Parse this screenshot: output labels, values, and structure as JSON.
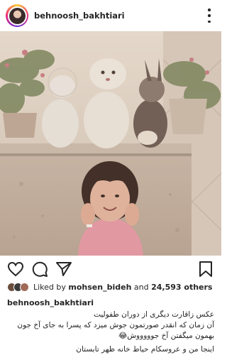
{
  "post": {
    "username": "behnoosh_bakhtiari",
    "more_icon": "more-vertical-icon"
  },
  "photo": {
    "description_icon": "childhood-photo"
  },
  "actions": {
    "like_icon": "heart-icon",
    "comment_icon": "comment-icon",
    "share_icon": "send-icon",
    "save_icon": "bookmark-icon"
  },
  "likes": {
    "prefix": "Liked by",
    "user": "mohsen_bideh",
    "and": "and",
    "count": "24,593 others"
  },
  "caption": {
    "username": "behnoosh_bakhtiari",
    "line1": "عکس زاقارت دیگری از دوران طفولیت",
    "line2": "آن زمان که انقدر صورتمون جوش میزد که پسرا به جای آخ جون",
    "line3": "بهمون میگفتن آخ جوووووش😂",
    "line4": "اینجا من و عروسکام حیاط خانه ظهر تابستان"
  },
  "colors": {
    "text": "#262626",
    "photo_sepia": "#c8b9ad"
  }
}
